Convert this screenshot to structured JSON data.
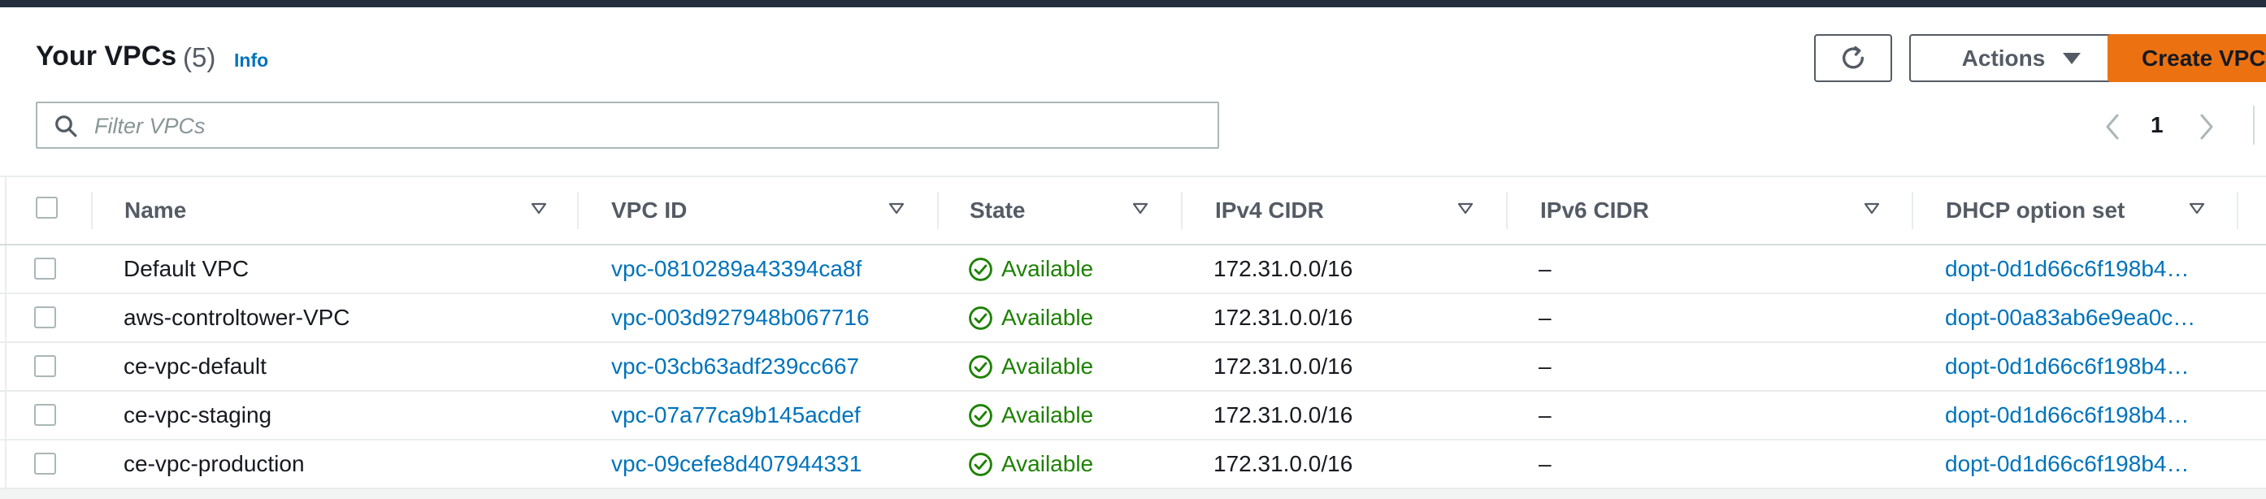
{
  "header": {
    "title": "Your VPCs",
    "count": "(5)",
    "info_label": "Info",
    "actions_label": "Actions",
    "create_label": "Create VPC"
  },
  "filter": {
    "placeholder": "Filter VPCs"
  },
  "pagination": {
    "current_page": "1"
  },
  "columns": [
    "Name",
    "VPC ID",
    "State",
    "IPv4 CIDR",
    "IPv6 CIDR",
    "DHCP option set"
  ],
  "rows": [
    {
      "name": "Default VPC",
      "vpc_id": "vpc-0810289a43394ca8f",
      "state": "Available",
      "ipv4_cidr": "172.31.0.0/16",
      "ipv6_cidr": "–",
      "dhcp_option_set": "dopt-0d1d66c6f198b4…"
    },
    {
      "name": "aws-controltower-VPC",
      "vpc_id": "vpc-003d927948b067716",
      "state": "Available",
      "ipv4_cidr": "172.31.0.0/16",
      "ipv6_cidr": "–",
      "dhcp_option_set": "dopt-00a83ab6e9ea0c…"
    },
    {
      "name": "ce-vpc-default",
      "vpc_id": "vpc-03cb63adf239cc667",
      "state": "Available",
      "ipv4_cidr": "172.31.0.0/16",
      "ipv6_cidr": "–",
      "dhcp_option_set": "dopt-0d1d66c6f198b4…"
    },
    {
      "name": "ce-vpc-staging",
      "vpc_id": "vpc-07a77ca9b145acdef",
      "state": "Available",
      "ipv4_cidr": "172.31.0.0/16",
      "ipv6_cidr": "–",
      "dhcp_option_set": "dopt-0d1d66c6f198b4…"
    },
    {
      "name": "ce-vpc-production",
      "vpc_id": "vpc-09cefe8d407944331",
      "state": "Available",
      "ipv4_cidr": "172.31.0.0/16",
      "ipv6_cidr": "–",
      "dhcp_option_set": "dopt-0d1d66c6f198b4…"
    }
  ],
  "icons": {
    "search": "search-icon",
    "refresh": "refresh-icon",
    "dropdown": "caret-down-icon",
    "sort": "sort-caret-icon",
    "state": "check-circle-icon",
    "prev": "chevron-left-icon",
    "next": "chevron-right-icon"
  },
  "colors": {
    "accent": "#ec7211",
    "link": "#0073bb",
    "success": "#1d8102",
    "topbar": "#232f3e"
  }
}
